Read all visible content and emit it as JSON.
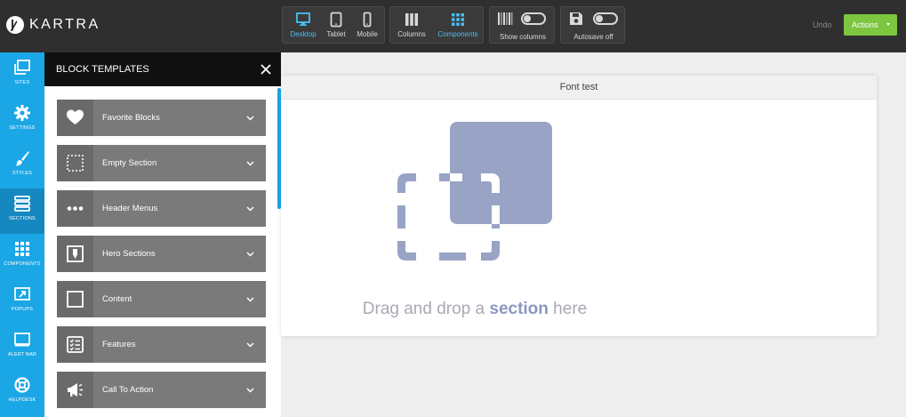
{
  "app": {
    "brand": "KARTRA"
  },
  "toolbar": {
    "views": [
      {
        "label": "Desktop",
        "icon": "desktop-icon",
        "active": true
      },
      {
        "label": "Tablet",
        "icon": "tablet-icon",
        "active": false
      },
      {
        "label": "Mobile",
        "icon": "mobile-icon",
        "active": false
      }
    ],
    "layout": [
      {
        "label": "Columns",
        "icon": "columns-icon",
        "active": false
      },
      {
        "label": "Components",
        "icon": "components-icon",
        "active": true
      }
    ],
    "show_columns_label": "Show columns",
    "autosave_label": "Autosave off",
    "undo_label": "Undo",
    "actions_label": "Actions"
  },
  "leftnav": {
    "items": [
      {
        "label": "SITES",
        "icon": "sites-icon"
      },
      {
        "label": "SETTINGS",
        "icon": "gear-icon"
      },
      {
        "label": "STYLES",
        "icon": "brush-icon"
      },
      {
        "label": "SECTIONS",
        "icon": "sections-icon",
        "active": true
      },
      {
        "label": "COMPONENTS",
        "icon": "components-grid-icon"
      },
      {
        "label": "POPUPS",
        "icon": "popup-icon"
      },
      {
        "label": "ALERT BAR",
        "icon": "alert-bar-icon"
      },
      {
        "label": "HELPDESK",
        "icon": "lifebuoy-icon"
      }
    ]
  },
  "panel": {
    "title": "BLOCK TEMPLATES",
    "blocks": [
      {
        "label": "Favorite Blocks",
        "icon": "heart-icon"
      },
      {
        "label": "Empty Section",
        "icon": "dashed-square-icon"
      },
      {
        "label": "Header Menus",
        "icon": "dots-icon"
      },
      {
        "label": "Hero Sections",
        "icon": "hero-icon"
      },
      {
        "label": "Content",
        "icon": "square-outline-icon"
      },
      {
        "label": "Features",
        "icon": "checklist-icon"
      },
      {
        "label": "Call To Action",
        "icon": "megaphone-icon"
      }
    ]
  },
  "canvas": {
    "title": "Font test",
    "drop_prefix": "Drag and drop a ",
    "drop_bold": "section",
    "drop_suffix": " here"
  },
  "colors": {
    "accent": "#1ba6e6",
    "active_tool": "#48c0f5",
    "actions_button": "#7dc63f",
    "illustration": "#99a3c6"
  }
}
